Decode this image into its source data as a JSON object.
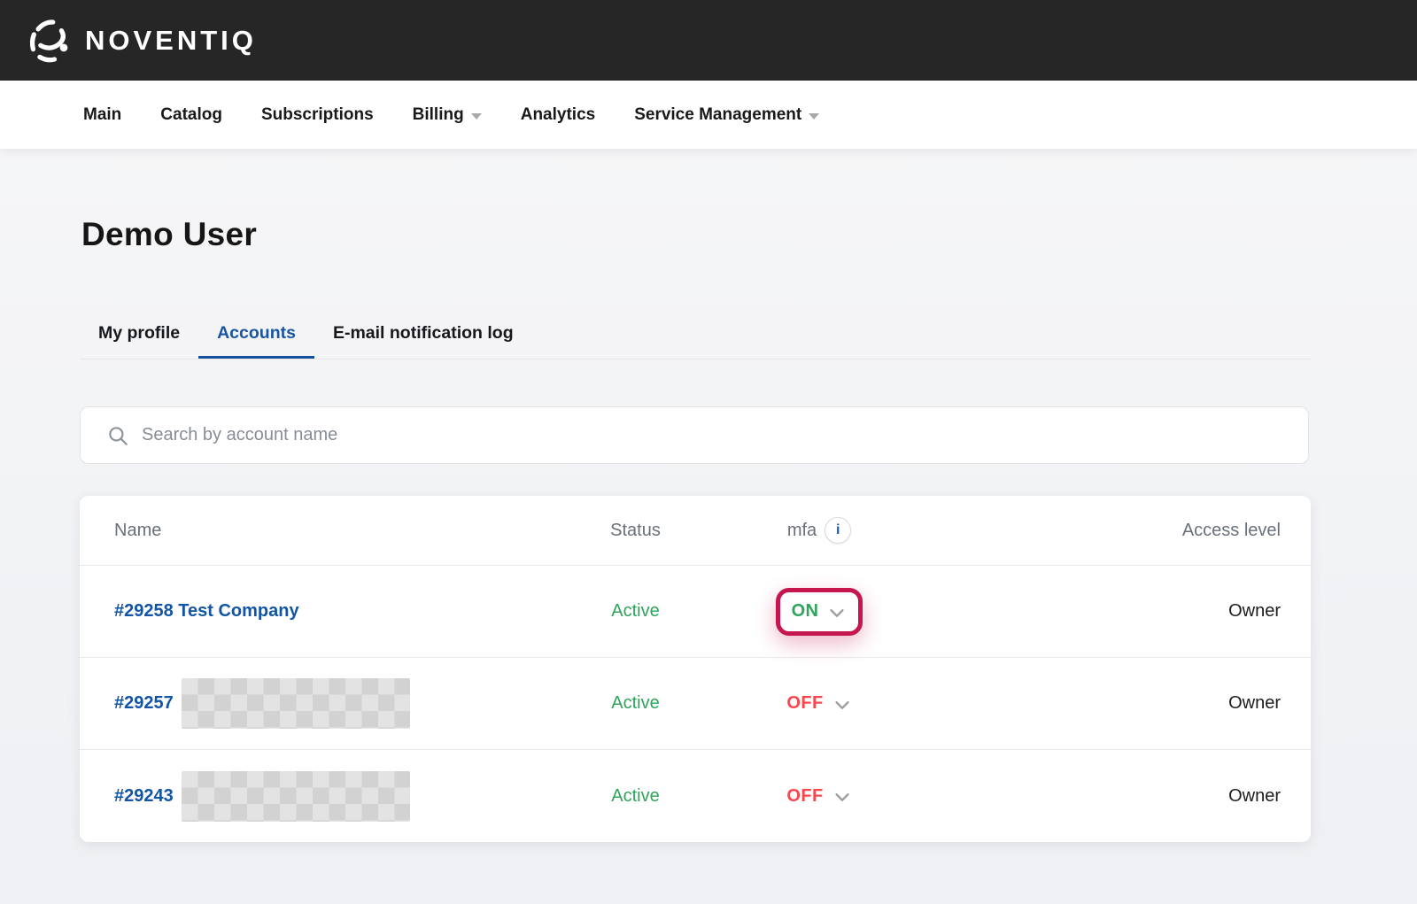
{
  "brand": {
    "name": "NOVENTIQ"
  },
  "nav": {
    "items": [
      {
        "label": "Main",
        "dropdown": false
      },
      {
        "label": "Catalog",
        "dropdown": false
      },
      {
        "label": "Subscriptions",
        "dropdown": false
      },
      {
        "label": "Billing",
        "dropdown": true
      },
      {
        "label": "Analytics",
        "dropdown": false
      },
      {
        "label": "Service Management",
        "dropdown": true
      }
    ]
  },
  "page": {
    "title": "Demo User"
  },
  "tabs": {
    "items": [
      {
        "label": "My profile",
        "active": false
      },
      {
        "label": "Accounts",
        "active": true
      },
      {
        "label": "E-mail notification log",
        "active": false
      }
    ]
  },
  "search": {
    "placeholder": "Search by account name",
    "value": ""
  },
  "accounts_table": {
    "headers": {
      "name": "Name",
      "status": "Status",
      "mfa": "mfa",
      "access_level": "Access level"
    },
    "info_icon": "i",
    "rows": [
      {
        "name": "#29258 Test Company",
        "name_redacted": false,
        "status": "Active",
        "mfa": "ON",
        "highlighted": true,
        "access_level": "Owner"
      },
      {
        "name": "#29257",
        "name_redacted": true,
        "status": "Active",
        "mfa": "OFF",
        "highlighted": false,
        "access_level": "Owner"
      },
      {
        "name": "#29243",
        "name_redacted": true,
        "status": "Active",
        "mfa": "OFF",
        "highlighted": false,
        "access_level": "Owner"
      }
    ]
  },
  "colors": {
    "header_bg": "#262626",
    "link_blue": "#1254a5",
    "tab_active_blue": "#1a55a4",
    "status_green": "#2da55a",
    "mfa_off_red": "#f8484e",
    "highlight_crimson": "#c5164d"
  }
}
